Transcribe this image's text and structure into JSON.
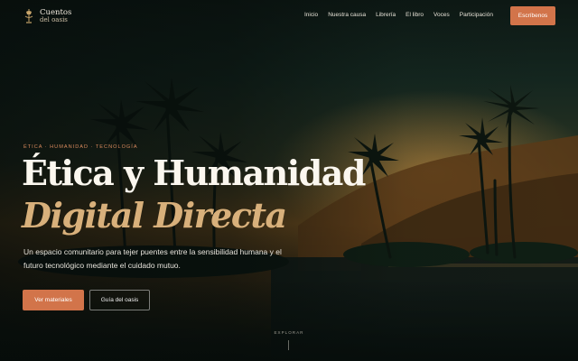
{
  "brand": {
    "name": "Cuentos",
    "subtitle": "del oasis",
    "icon": "lamp-icon"
  },
  "nav": {
    "links": [
      {
        "label": "Inicio"
      },
      {
        "label": "Nuestra causa"
      },
      {
        "label": "Librería"
      },
      {
        "label": "El libro"
      },
      {
        "label": "Voces"
      },
      {
        "label": "Participación"
      }
    ],
    "cta_label": "Escríbenos"
  },
  "hero": {
    "eyebrow": "ÉTICA · HUMANIDAD · TECNOLOGÍA",
    "title_line1": "Ética y Humanidad",
    "title_line2": "Digital Directa",
    "description": "Un espacio comunitario para tejer puentes entre la sensibilidad humana y el futuro tecnológico mediante el cuidado mutuo.",
    "primary_button": "Ver materiales",
    "secondary_button": "Guía del oasis",
    "scroll_hint": "EXPLORAR"
  },
  "colors": {
    "accent": "#d2744a",
    "gold": "#d8b07b",
    "background": "#0d1612"
  }
}
